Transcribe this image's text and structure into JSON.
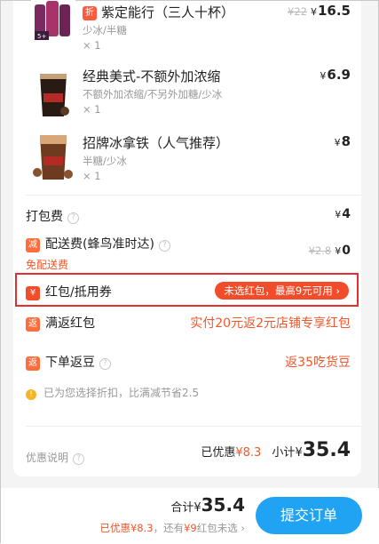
{
  "items": [
    {
      "name": "紫定能行（三人十杯）",
      "spec": "少冰/半糖",
      "qty": "× 1",
      "discount_tag": "折",
      "old_price": "¥22",
      "yen": "¥",
      "price": "16.5"
    },
    {
      "name": "经典美式-不额外加浓缩",
      "spec": "不额外加浓缩/不另外加糖/少冰",
      "qty": "× 1",
      "yen": "¥",
      "price": "6.9"
    },
    {
      "name": "招牌冰拿铁（人气推荐）",
      "spec": "半糖/少冰",
      "qty": "× 1",
      "yen": "¥",
      "price": "8"
    }
  ],
  "fees": {
    "packing_label": "打包费",
    "packing_yen": "¥",
    "packing_value": "4",
    "delivery_tag": "减",
    "delivery_label": "配送费(蜂鸟准时达)",
    "delivery_note": "免配送费",
    "delivery_old": "¥2.8",
    "delivery_yen": "¥",
    "delivery_value": "0"
  },
  "coupon": {
    "tag": "¥",
    "label": "红包/抵用券",
    "pill": "未选红包，最高9元可用 ›"
  },
  "rebate": {
    "tag": "返",
    "label": "满返红包",
    "value": "实付20元返2元店铺专享红包"
  },
  "beans": {
    "tag": "返",
    "label": "下单返豆",
    "value": "返35吃货豆"
  },
  "notice": {
    "icon": "!",
    "text": "已为您选择折扣，比满减节省2.5"
  },
  "summary": {
    "left_label": "优惠说明",
    "discount_label": "已优惠",
    "discount_value": "¥8.3",
    "subtotal_label": "小计",
    "subtotal_yen": "¥",
    "subtotal_value": "35.4"
  },
  "bottom": {
    "total_label": "合计",
    "total_yen": "¥",
    "total_value": "35.4",
    "sub_discount": "已优惠¥8.3",
    "sub_sep": "，还有",
    "sub_remaining": "¥9",
    "sub_rest": "红包未选 ›",
    "submit": "提交订单"
  },
  "colors": {
    "accent_orange": "#f2572b",
    "submit_blue": "#21a3f3",
    "highlight_red": "#e03030"
  }
}
